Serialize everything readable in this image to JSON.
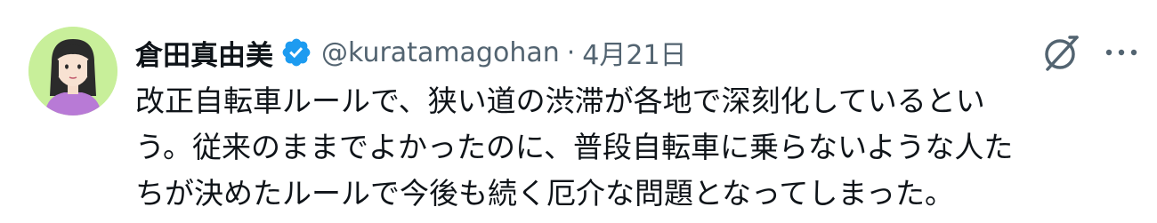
{
  "author": {
    "name": "倉田真由美",
    "handle": "@kuratamagohan",
    "separator": "·",
    "date": "4月21日"
  },
  "icons": {
    "avatar": "avatar",
    "verified": "verified-badge-icon",
    "grok": "grok-icon",
    "more": "more-icon"
  },
  "colors": {
    "verified": "#1d9bf0",
    "secondary_text": "#536471",
    "avatar_bg": "#c8ef9a"
  },
  "tweet": {
    "lines": [
      "改正自転車ルールで、狭い道の渋滞が各地で深刻化しているとい",
      "う。従来のままでよかったのに、普段自転車に乗らないような人た",
      "ちが決めたルールで今後も続く厄介な問題となってしまった。"
    ]
  }
}
